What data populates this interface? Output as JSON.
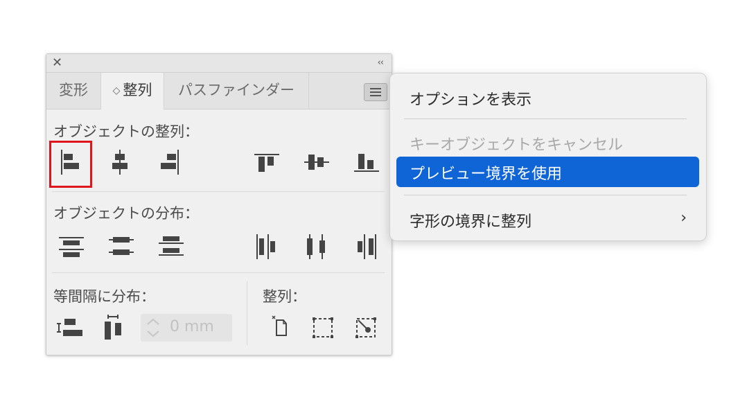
{
  "panel": {
    "close_glyph": "✕",
    "collapse_glyph": "‹‹",
    "tabs": [
      {
        "label": "変形"
      },
      {
        "label": "整列",
        "arrows": "◇"
      },
      {
        "label": "パスファインダー"
      }
    ],
    "menu_icon": "hamburger-menu-icon",
    "sections": {
      "align_objects": "オブジェクトの整列：",
      "distribute_objects": "オブジェクトの分布：",
      "distribute_spacing": "等間隔に分布：",
      "align_to": "整列："
    },
    "spacing_value": "0 mm",
    "selected_highlight_color": "#e0141b"
  },
  "menu": {
    "items": [
      {
        "label": "オプションを表示",
        "state": "normal"
      },
      {
        "label": "キーオブジェクトをキャンセル",
        "state": "disabled"
      },
      {
        "label": "プレビュー境界を使用",
        "state": "highlighted"
      },
      {
        "label": "字形の境界に整列",
        "state": "submenu",
        "chevron": "›"
      }
    ],
    "highlight_color": "#0f64d6"
  }
}
